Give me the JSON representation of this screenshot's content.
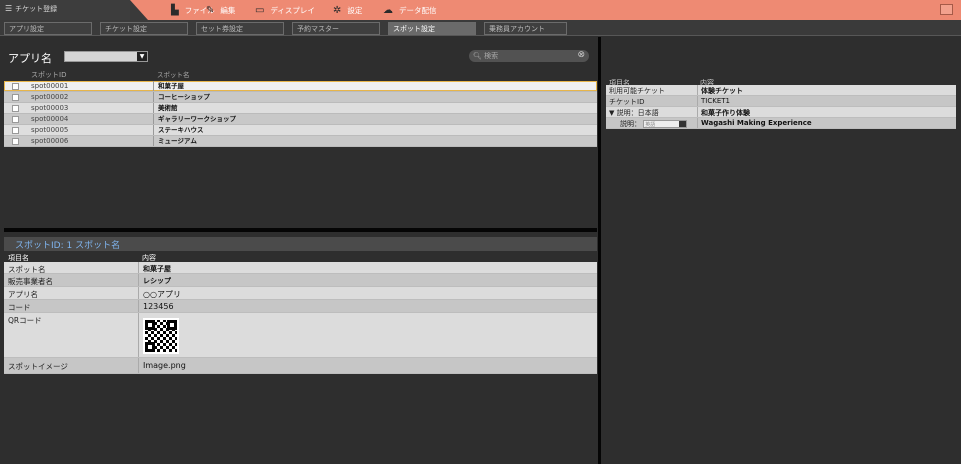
{
  "app": {
    "title": "チケット登録"
  },
  "menu": [
    {
      "icon": "file-icon",
      "glyph": "▙",
      "label": "ファイル"
    },
    {
      "icon": "pencil-icon",
      "glyph": "✎",
      "label": "編集"
    },
    {
      "icon": "monitor-icon",
      "glyph": "▭",
      "label": "ディスプレイ"
    },
    {
      "icon": "gear-icon",
      "glyph": "✲",
      "label": "設定"
    },
    {
      "icon": "cloud-upload-icon",
      "glyph": "☁",
      "label": "データ配信"
    }
  ],
  "tabs": [
    "アプリ設定",
    "チケット設定",
    "セット券設定",
    "予約マスター",
    "スポット設定",
    "乗務員アカウント"
  ],
  "active_tab": "スポット設定",
  "filter": {
    "label": "アプリ名",
    "value": ""
  },
  "search": {
    "placeholder": "検索"
  },
  "spot_table": {
    "headers": {
      "id": "スポットID",
      "name": "スポット名"
    },
    "rows": [
      {
        "id": "spot00001",
        "name": "和菓子屋"
      },
      {
        "id": "spot00002",
        "name": "コーヒーショップ"
      },
      {
        "id": "spot00003",
        "name": "美術館"
      },
      {
        "id": "spot00004",
        "name": "ギャラリーワークショップ"
      },
      {
        "id": "spot00005",
        "name": "ステーキハウス"
      },
      {
        "id": "spot00006",
        "name": "ミュージアム"
      }
    ]
  },
  "detail": {
    "title": "スポットID: 1 スポット名",
    "headers": {
      "key": "項目名",
      "value": "内容"
    },
    "rows": [
      {
        "key": "スポット名",
        "value": "和菓子屋"
      },
      {
        "key": "販売事業者名",
        "value": "レシップ"
      },
      {
        "key": "アプリ名",
        "value": "○○アプリ"
      },
      {
        "key": "コード",
        "value": "123456"
      },
      {
        "key": "QRコード",
        "value": ""
      },
      {
        "key": "スポットイメージ",
        "value": "Image.png"
      }
    ]
  },
  "right_table": {
    "headers": {
      "key": "項目名",
      "value": "内容"
    },
    "rows": [
      {
        "key": "利用可能チケット",
        "value": "体験チケット"
      },
      {
        "key": "チケットID",
        "value": "TICKET1"
      },
      {
        "key": "▼ 説明：日本語",
        "value": "和菓子作り体験"
      },
      {
        "key": "説明：",
        "select": "英語",
        "value": "Wagashi Making Experience"
      }
    ]
  },
  "colors": {
    "menubar": "#ee8a73",
    "detail_title": "#7fb4ee",
    "selected_border": "#e7b54a"
  }
}
